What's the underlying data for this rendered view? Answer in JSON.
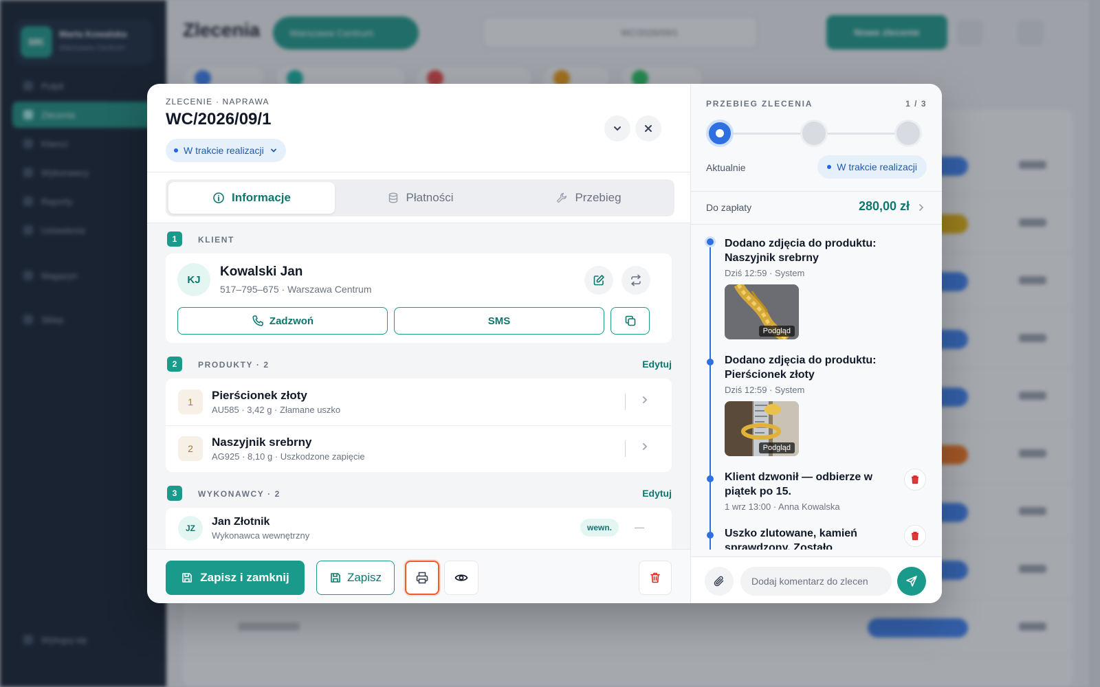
{
  "background": {
    "sidebar_user_initials": "MK",
    "sidebar_user_name": "Marta Kowalska",
    "sidebar_user_role": "Warszawa Centrum",
    "sidebar_items": [
      "Pulpit",
      "Zlecenia",
      "Klienci",
      "Wykonawcy",
      "Raporty",
      "Ustawienia",
      "Magazyn",
      "Sklep"
    ],
    "sidebar_logout": "Wyloguj się",
    "page_title": "Zlecenia",
    "location": "Warszawa Centrum",
    "search_value": "WC/2026/09/1",
    "new_order": "Nowe zlecenie"
  },
  "modal": {
    "kicker": "ZLECENIE · NAPRAWA",
    "title": "WC/2026/09/1",
    "status": "W trakcie realizacji",
    "tabs": [
      {
        "label": "Informacje",
        "icon": "info-icon",
        "active": true
      },
      {
        "label": "Płatności",
        "icon": "database-icon",
        "active": false
      },
      {
        "label": "Przebieg",
        "icon": "wrench-icon",
        "active": false
      }
    ],
    "client_section": {
      "num": "1",
      "label": "KLIENT"
    },
    "client": {
      "initials": "KJ",
      "name": "Kowalski Jan",
      "sub": "517–795–675 · Warszawa Centrum",
      "call_label": "Zadzwoń",
      "sms_label": "SMS"
    },
    "products_section": {
      "num": "2",
      "label": "PRODUKTY · 2",
      "edit": "Edytuj"
    },
    "products": [
      {
        "num": "1",
        "name": "Pierścionek złoty",
        "meta": "AU585 · 3,42 g · Złamane uszko"
      },
      {
        "num": "2",
        "name": "Naszyjnik srebrny",
        "meta": "AG925 · 8,10 g · Uszkodzone zapięcie"
      }
    ],
    "contractors_section": {
      "num": "3",
      "label": "WYKONAWCY · 2",
      "edit": "Edytuj"
    },
    "contractor": {
      "initials": "JZ",
      "name": "Jan Złotnik",
      "sub": "Wykonawca wewnętrzny",
      "tag": "wewn.",
      "dash": "—"
    },
    "footer": {
      "save_close": "Zapisz i zamknij",
      "save": "Zapisz"
    }
  },
  "panel": {
    "kicker": "PRZEBIEG ZLECENIA",
    "step_count": "1 / 3",
    "current_step": 1,
    "now_label": "Aktualnie",
    "status": "W trakcie realizacji",
    "pay_label": "Do zapłaty",
    "pay_amount": "280,00 zł",
    "events": [
      {
        "title": "Dodano zdjęcia do produktu: Naszyjnik srebrny",
        "meta": "Dziś 12:59 · System",
        "thumb_label": "Podgląd"
      },
      {
        "title": "Dodano zdjęcia do produktu: Pierścionek złoty",
        "meta": "Dziś 12:59 · System",
        "thumb_label": "Podgląd"
      },
      {
        "title": "Klient dzwonił — odbierze w piątek po 15.",
        "meta": "1 wrz 13:00 · Anna Kowalska"
      },
      {
        "title": "Uszko zlutowane, kamień sprawdzony. Zostało",
        "meta": ""
      }
    ],
    "comment_placeholder": "Dodaj komentarz do zlecen"
  },
  "colors": {
    "accent": "#1a9a8a",
    "accent_dark": "#0f766e",
    "status_blue": "#2563eb",
    "focus_orange": "#f05a28",
    "danger": "#dc2626"
  }
}
